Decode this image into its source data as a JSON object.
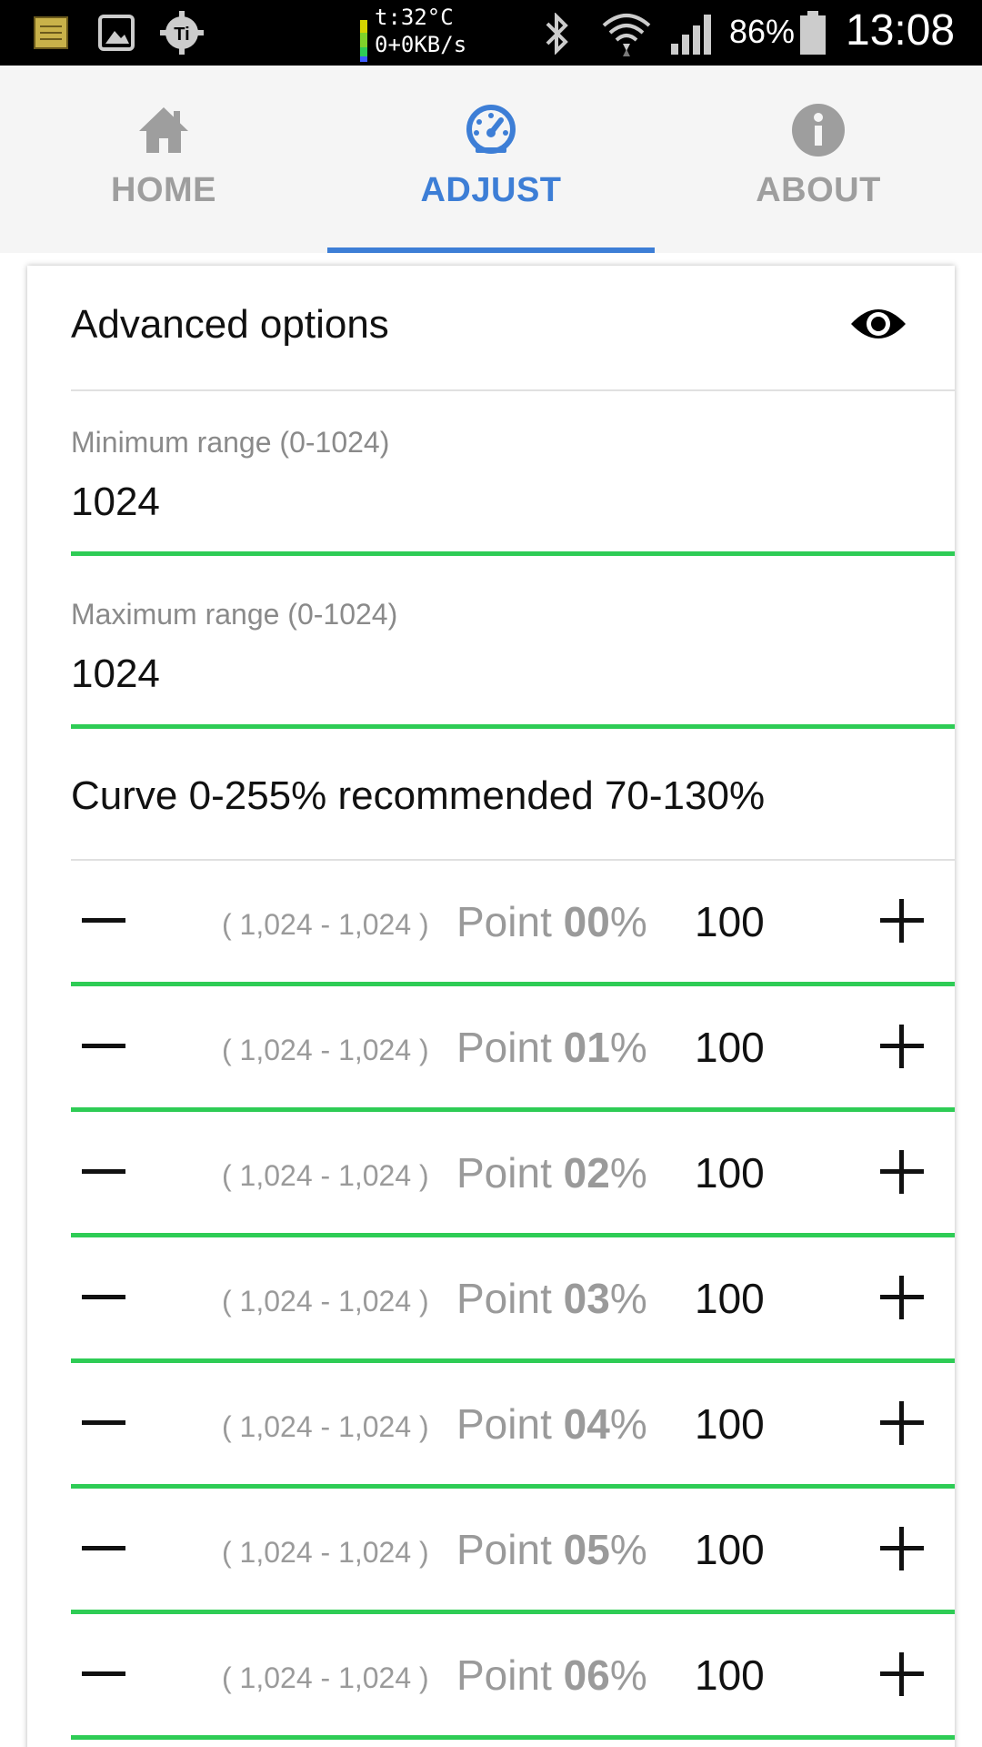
{
  "status_bar": {
    "net_line1": "t:32°C",
    "net_line2": "0+0KB/s",
    "battery_percent": "86%",
    "clock": "13:08",
    "icons": [
      "notes-icon",
      "gallery-icon",
      "ti-gear-icon",
      "bluetooth-icon",
      "wifi-icon",
      "signal-icon",
      "battery-icon"
    ]
  },
  "tabs": [
    {
      "label": "HOME",
      "icon": "home-icon",
      "active": false
    },
    {
      "label": "ADJUST",
      "icon": "speedometer-icon",
      "active": true
    },
    {
      "label": "ABOUT",
      "icon": "info-icon",
      "active": false
    }
  ],
  "colors": {
    "accent": "#3d7ed6",
    "field_line": "#2ecc55",
    "inactive_tab": "#9e9e9e"
  },
  "card": {
    "title": "Advanced options",
    "toggle_icon": "eye-icon",
    "min_field": {
      "label": "Minimum range (0-1024)",
      "value": "1024"
    },
    "max_field": {
      "label": "Maximum range (0-1024)",
      "value": "1024"
    },
    "curve_text": "Curve 0-255% recommended 70-130%",
    "points": [
      {
        "range": "( 1,024 - 1,024 )",
        "prefix": "Point ",
        "index": "00",
        "suffix": "%",
        "value": "100"
      },
      {
        "range": "( 1,024 - 1,024 )",
        "prefix": "Point ",
        "index": "01",
        "suffix": "%",
        "value": "100"
      },
      {
        "range": "( 1,024 - 1,024 )",
        "prefix": "Point ",
        "index": "02",
        "suffix": "%",
        "value": "100"
      },
      {
        "range": "( 1,024 - 1,024 )",
        "prefix": "Point ",
        "index": "03",
        "suffix": "%",
        "value": "100"
      },
      {
        "range": "( 1,024 - 1,024 )",
        "prefix": "Point ",
        "index": "04",
        "suffix": "%",
        "value": "100"
      },
      {
        "range": "( 1,024 - 1,024 )",
        "prefix": "Point ",
        "index": "05",
        "suffix": "%",
        "value": "100"
      },
      {
        "range": "( 1,024 - 1,024 )",
        "prefix": "Point ",
        "index": "06",
        "suffix": "%",
        "value": "100"
      }
    ]
  }
}
